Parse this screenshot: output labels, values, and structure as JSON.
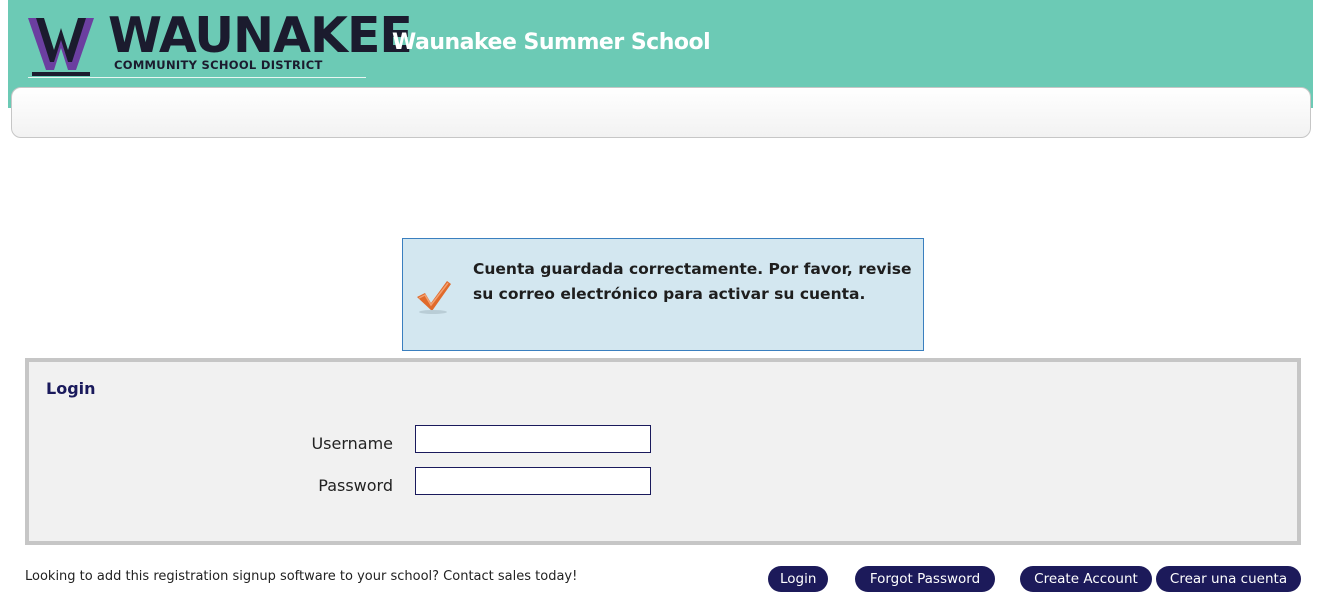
{
  "header": {
    "logo": {
      "name": "WAUNAKEE",
      "subtitle": "COMMUNITY SCHOOL DISTRICT"
    },
    "title": "Waunakee Summer School",
    "colors": {
      "header_bg": "#6ccab5",
      "logo_purple": "#6b3fa0",
      "logo_dark": "#1b1b2e"
    }
  },
  "message": {
    "icon": "checkmark-icon",
    "text": "Cuenta guardada correctamente. Por favor, revise su correo electrónico para activar su cuenta."
  },
  "login": {
    "title": "Login",
    "username_label": "Username",
    "username_value": "",
    "password_label": "Password",
    "password_value": ""
  },
  "footer": {
    "promo_text": "Looking to add this registration signup software to your school? Contact sales today!",
    "buttons": {
      "login": "Login",
      "forgot_password": "Forgot Password",
      "create_account": "Create Account",
      "crear_cuenta": "Crear una cuenta"
    },
    "button_color": "#1c1a5a"
  }
}
